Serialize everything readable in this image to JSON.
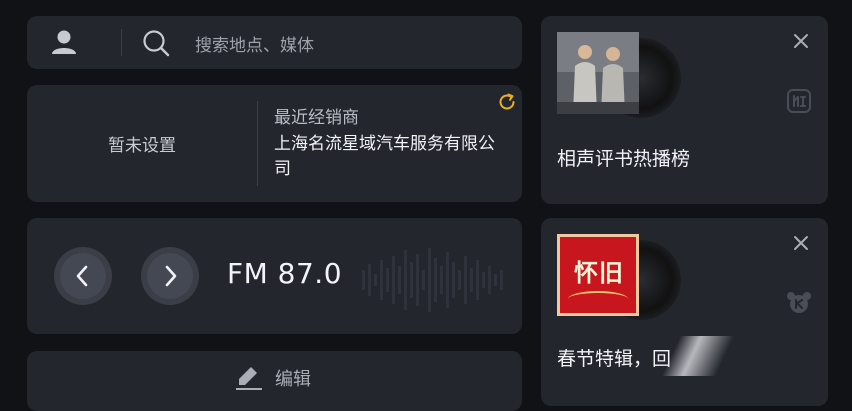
{
  "search": {
    "placeholder": "搜索地点、媒体"
  },
  "dealer": {
    "unset_label": "暂未设置",
    "recent_label": "最近经销商",
    "dealer_name": "上海名流星域汽车服务有限公司"
  },
  "radio": {
    "frequency": "FM 87.0"
  },
  "edit": {
    "label": "编辑"
  },
  "media_cards": [
    {
      "title": "相声评书热播榜",
      "side_icon": "listen-icon"
    },
    {
      "title": "春节特辑，回",
      "cover_text": "怀旧",
      "side_icon": "kaola-icon"
    }
  ],
  "colors": {
    "background": "#111216",
    "card": "#24262e",
    "accent_refresh": "#e8b021",
    "cover_red": "#c8161e"
  }
}
